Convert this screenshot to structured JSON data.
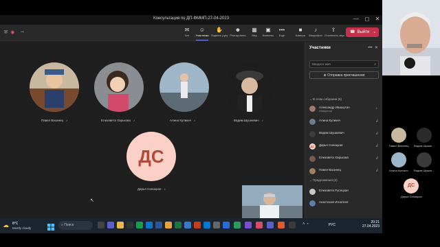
{
  "window": {
    "title": "Консультация по ДП-ФММП-27-04-2023",
    "controls": [
      "—",
      "◻",
      "✕"
    ]
  },
  "toolbar": {
    "timer": "•••",
    "buttons": [
      {
        "icon": "chat-icon",
        "glyph": "✉",
        "label": "Чат"
      },
      {
        "icon": "people-icon",
        "glyph": "☺",
        "label": "Участники"
      },
      {
        "icon": "hand-icon",
        "glyph": "✋",
        "label": "Поднять руку"
      },
      {
        "icon": "reactions-icon",
        "glyph": "☻",
        "label": "Реагировать"
      },
      {
        "icon": "view-icon",
        "glyph": "▦",
        "label": "Вид"
      },
      {
        "icon": "rooms-icon",
        "glyph": "▣",
        "label": "Комнаты"
      },
      {
        "icon": "more-icon",
        "glyph": "•••",
        "label": "Еще"
      },
      {
        "icon": "camera-icon",
        "glyph": "■",
        "label": "Камера"
      },
      {
        "icon": "mic-icon",
        "glyph": "♪",
        "label": "Микрофон"
      },
      {
        "icon": "share-icon",
        "glyph": "⇪",
        "label": "Отключить звук"
      }
    ],
    "leave_label": "Выйти"
  },
  "tiles": [
    {
      "name": "Павел Васинец"
    },
    {
      "name": "Елизавета Харькова"
    },
    {
      "name": "Алина Куликич"
    },
    {
      "name": "Вадим Шушкевич"
    },
    {
      "name": "Дарья Синицкая",
      "initials": "ДС"
    }
  ],
  "panel": {
    "title": "Участники",
    "search_placeholder": "Введите имя",
    "invite_label": "Отправка приглашения",
    "in_meeting_label": "В этом собрании (6)",
    "suggested_label": "Предложения (2)",
    "in_meeting": [
      {
        "name": "Александр Ивашутин",
        "role": "Инициатор",
        "color": "#9c7b6a"
      },
      {
        "name": "Алина Куликич",
        "role": "",
        "color": "#6c7d8e"
      },
      {
        "name": "Вадим Шушкевич",
        "role": "",
        "color": "#3d3d3d"
      },
      {
        "name": "Дарья Синицкая",
        "role": "",
        "color": "#fbd0c7",
        "initials": "ДС"
      },
      {
        "name": "Елизавета Харькова",
        "role": "",
        "color": "#7a5a48"
      },
      {
        "name": "Павел Васинец",
        "role": "",
        "color": "#a08060"
      }
    ],
    "suggested": [
      {
        "name": "Елизавета Русецкая",
        "color": "#c9c9c9"
      },
      {
        "name": "Анастасия Игнатеня",
        "color": "#5b7fa8"
      }
    ]
  },
  "strip": [
    {
      "name": "Павел Васинец"
    },
    {
      "name": "Вадим Шушке..."
    },
    {
      "name": "Алина Куликич"
    },
    {
      "name": "Вадим Шушке..."
    },
    {
      "name": "Дарья Синицкая",
      "initials": "ДС"
    }
  ],
  "taskbar": {
    "temp": "8°C",
    "weather": "Mostly cloudy",
    "search": "Поиск",
    "lang": "РУС",
    "time": "20:21",
    "date": "27.04.2023"
  },
  "colors": {
    "leave": "#c4314b",
    "accent": "#7f85f5",
    "initials_bg": "#fbd0c7",
    "initials_fg": "#b24a3a"
  }
}
